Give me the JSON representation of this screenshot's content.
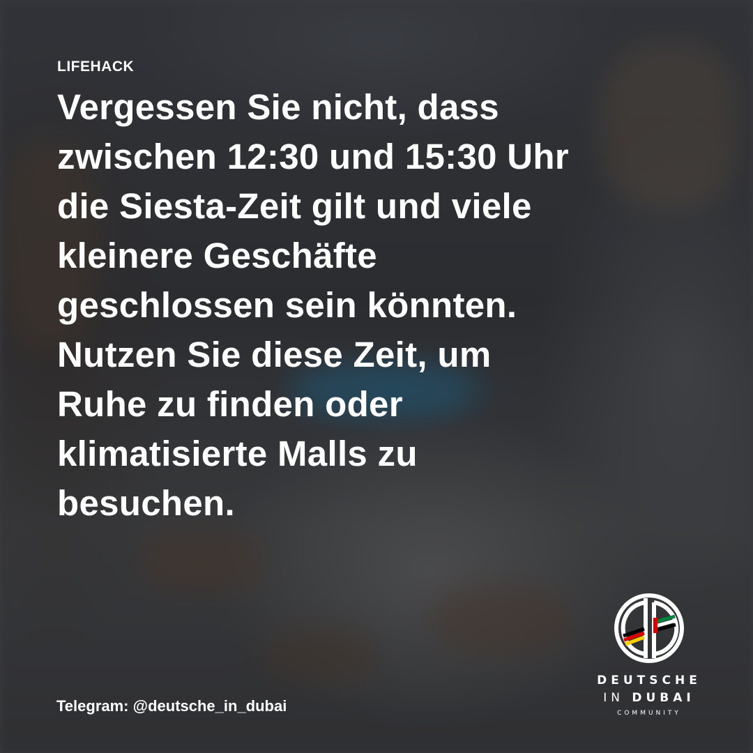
{
  "tag": "LIFEHACK",
  "headline_lines": [
    "Vergessen Sie nicht, dass",
    "zwischen 12:30 und 15:30 Uhr",
    "die Siesta-Zeit gilt und viele",
    "kleinere Geschäfte",
    "geschlossen sein könnten.",
    "Nutzen Sie diese Zeit, um",
    "Ruhe zu finden oder",
    "klimatisierte Malls zu",
    "besuchen."
  ],
  "footer": {
    "telegram": "Telegram: @deutsche_in_dubai"
  },
  "logo": {
    "line1": "DEUTSCHE",
    "line2_a": "IN ",
    "line2_b": "DUBAI",
    "line3": "COMMUNITY",
    "icon": "did-monogram-icon",
    "colors": {
      "black": "#000000",
      "red": "#dd0000",
      "gold": "#ffce00",
      "green": "#00843d",
      "white": "#ffffff"
    }
  }
}
